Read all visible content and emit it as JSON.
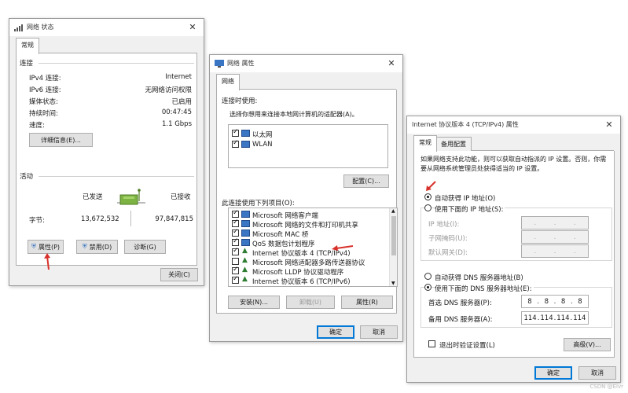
{
  "status_window": {
    "title": "网络 状态",
    "tab": "常规",
    "section_connection": "连接",
    "rows": [
      {
        "label": "IPv4 连接:",
        "value": "Internet"
      },
      {
        "label": "IPv6 连接:",
        "value": "无网络访问权限"
      },
      {
        "label": "媒体状态:",
        "value": "已启用"
      },
      {
        "label": "持续时间:",
        "value": "00:47:45"
      },
      {
        "label": "速度:",
        "value": "1.1 Gbps"
      }
    ],
    "details_button": "详细信息(E)...",
    "section_activity": "活动",
    "sent_label": "已发送",
    "received_label": "已接收",
    "bytes_label": "字节:",
    "bytes_sent": "13,672,532",
    "bytes_received": "97,847,815",
    "properties_button": "属性(P)",
    "disable_button": "禁用(D)",
    "diagnose_button": "诊断(G)",
    "close_button": "关闭(C)"
  },
  "properties_window": {
    "title": "网络 属性",
    "tab": "网络",
    "connect_using_label": "连接时使用:",
    "adapter_prompt": "选择你想用来连接本地网计算机的适配器(A)。",
    "adapters": [
      {
        "label": "以太网",
        "checked": true
      },
      {
        "label": "WLAN",
        "checked": true
      }
    ],
    "configure_button": "配置(C)...",
    "items_label": "此连接使用下列项目(O):",
    "items": [
      {
        "label": "Microsoft 网络客户端",
        "checked": true
      },
      {
        "label": "Microsoft 网络的文件和打印机共享",
        "checked": true
      },
      {
        "label": "Microsoft MAC 桥",
        "checked": true
      },
      {
        "label": "QoS 数据包计划程序",
        "checked": true
      },
      {
        "label": "Internet 协议版本 4 (TCP/IPv4)",
        "checked": true
      },
      {
        "label": "Microsoft 网络适配器多路传送器协议",
        "checked": false
      },
      {
        "label": "Microsoft LLDP 协议驱动程序",
        "checked": true
      },
      {
        "label": "Internet 协议版本 6 (TCP/IPv6)",
        "checked": true
      }
    ],
    "install_button": "安装(N)...",
    "uninstall_button": "卸载(U)",
    "properties_button": "属性(R)",
    "ok_button": "确定",
    "cancel_button": "取消"
  },
  "ipv4_window": {
    "title": "Internet 协议版本 4 (TCP/IPv4) 属性",
    "tab_general": "常规",
    "tab_alternate": "备用配置",
    "description": "如果网络支持此功能，则可以获取自动指派的 IP 设置。否则，你需要从网络系统管理员处获得适当的 IP 设置。",
    "auto_ip_label": "自动获得 IP 地址(O)",
    "manual_ip_label": "使用下面的 IP 地址(S):",
    "ip_address_label": "IP 地址(I):",
    "subnet_label": "子网掩码(U):",
    "gateway_label": "默认网关(D):",
    "auto_dns_label": "自动获得 DNS 服务器地址(B)",
    "manual_dns_label": "使用下面的 DNS 服务器地址(E):",
    "preferred_dns_label": "首选 DNS 服务器(P):",
    "alternate_dns_label": "备用 DNS 服务器(A):",
    "preferred_dns": [
      "8",
      "8",
      "8",
      "8"
    ],
    "alternate_dns": [
      "114",
      "114",
      "114",
      "114"
    ],
    "validate_label": "退出时验证设置(L)",
    "advanced_button": "高级(V)...",
    "ok_button": "确定",
    "cancel_button": "取消"
  },
  "watermark": "CSDN @Eivr",
  "colors": {
    "accent": "#0078d7",
    "arrow": "#d8312b",
    "network_icon": "#3a76c4"
  }
}
